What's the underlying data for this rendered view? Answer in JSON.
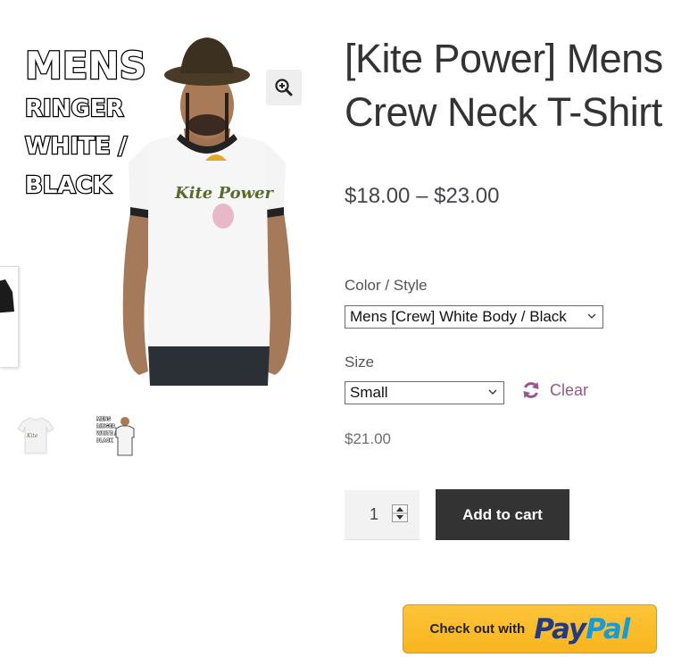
{
  "product": {
    "title": "[Kite Power] Mens Crew Neck T-Shirt",
    "price_range": "$18.00 – $23.00",
    "variation_price": "$21.00"
  },
  "gallery": {
    "main_image_text_lines": [
      "Mens",
      "Ringer",
      "White /",
      "Black"
    ],
    "shirt_print": "Kite Power",
    "thumbnail_text_lines": [
      "Mens",
      "Ringer",
      "White /",
      "Black"
    ],
    "zoom_icon": "zoom-in-magnifier-icon"
  },
  "variations": {
    "color_label": "Color / Style",
    "color_selected": "Mens [Crew] White Body / Black",
    "size_label": "Size",
    "size_selected": "Small",
    "clear_label": "Clear",
    "clear_icon": "refresh-icon"
  },
  "cart": {
    "quantity": "1",
    "add_label": "Add to cart"
  },
  "paypal": {
    "prefix": "Check out with",
    "logo_pay": "Pay",
    "logo_pal": "Pal"
  },
  "colors": {
    "button_dark": "#333333",
    "clear_purple": "#96588a",
    "paypal_yellow": "#ffc43a",
    "paypal_navy": "#253b80",
    "paypal_cyan": "#179bd7"
  }
}
